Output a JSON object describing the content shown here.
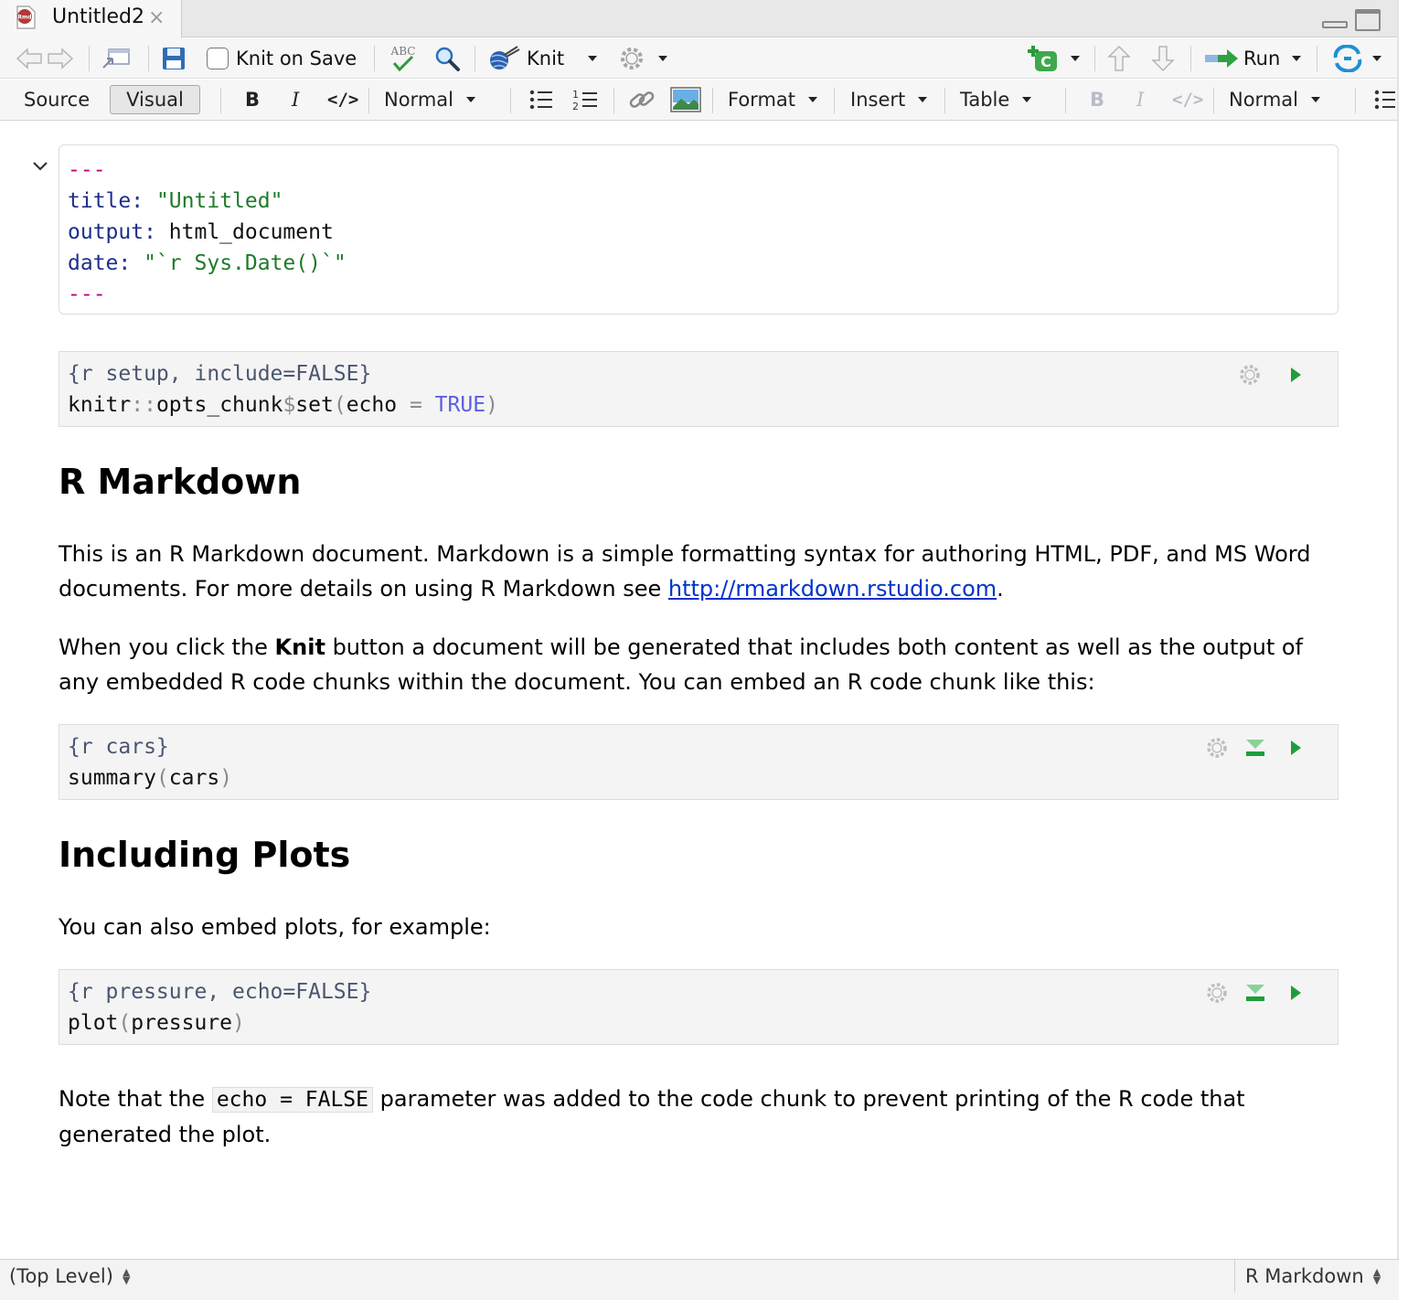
{
  "tab": {
    "title": "Untitled2",
    "close_glyph": "×",
    "file_type_icon": "rmd-file-icon"
  },
  "toolbar1": {
    "knit_on_save_label": "Knit on Save",
    "knit_label": "Knit",
    "run_label": "Run",
    "spellcheck_text": "ABC",
    "insert_chunk_letter": "C"
  },
  "toolbar2": {
    "source_label": "Source",
    "visual_label": "Visual",
    "bold_label": "B",
    "italic_label": "I",
    "code_label": "</>",
    "style_label": "Normal",
    "format_label": "Format",
    "insert_label": "Insert",
    "table_label": "Table",
    "bold2_label": "B",
    "italic2_label": "I",
    "code2_label": "</>",
    "style2_label": "Normal"
  },
  "yaml": {
    "dashes": "---",
    "title_key": "title:",
    "title_value": "\"Untitled\"",
    "output_key": "output:",
    "output_value": "html_document",
    "date_key": "date:",
    "date_value": "\"`r Sys.Date()`\""
  },
  "chunks": [
    {
      "header": "{r setup, include=FALSE}",
      "code_a": "knitr",
      "code_b": "::",
      "code_c": "opts_chunk",
      "code_d": "$",
      "code_e": "set",
      "code_f": "(",
      "code_g": "echo ",
      "code_h": "=",
      "code_i": " TRUE",
      "code_j": ")"
    },
    {
      "header": "{r cars}",
      "code_a": "summary",
      "code_b": "(",
      "code_c": "cars",
      "code_d": ")"
    },
    {
      "header": "{r pressure, echo=FALSE}",
      "code_a": "plot",
      "code_b": "(",
      "code_c": "pressure",
      "code_d": ")"
    }
  ],
  "content": {
    "heading1": "R Markdown",
    "para1_text": "This is an R Markdown document. Markdown is a simple formatting syntax for authoring HTML, PDF, and MS Word documents. For more details on using R Markdown see ",
    "para1_link": "http://rmarkdown.rstudio.com",
    "para1_end": ".",
    "para2_start": "When you click the ",
    "para2_bold": "Knit",
    "para2_end": " button a document will be generated that includes both content as well as the output of any embedded R code chunks within the document. You can embed an R code chunk like this:",
    "heading2": "Including Plots",
    "para3": "You can also embed plots, for example:",
    "para4_start": "Note that the ",
    "para4_code": "echo = FALSE",
    "para4_end": " parameter was added to the code chunk to prevent printing of the R code that generated the plot."
  },
  "statusbar": {
    "left_label": "(Top Level)",
    "right_label": "R Markdown"
  },
  "colors": {
    "yaml_dash": "#c0007a",
    "yaml_key": "#1d2f8c",
    "yaml_string": "#1f7a2a",
    "run_green": "#1e9e3a",
    "link_blue": "#0033cc"
  }
}
